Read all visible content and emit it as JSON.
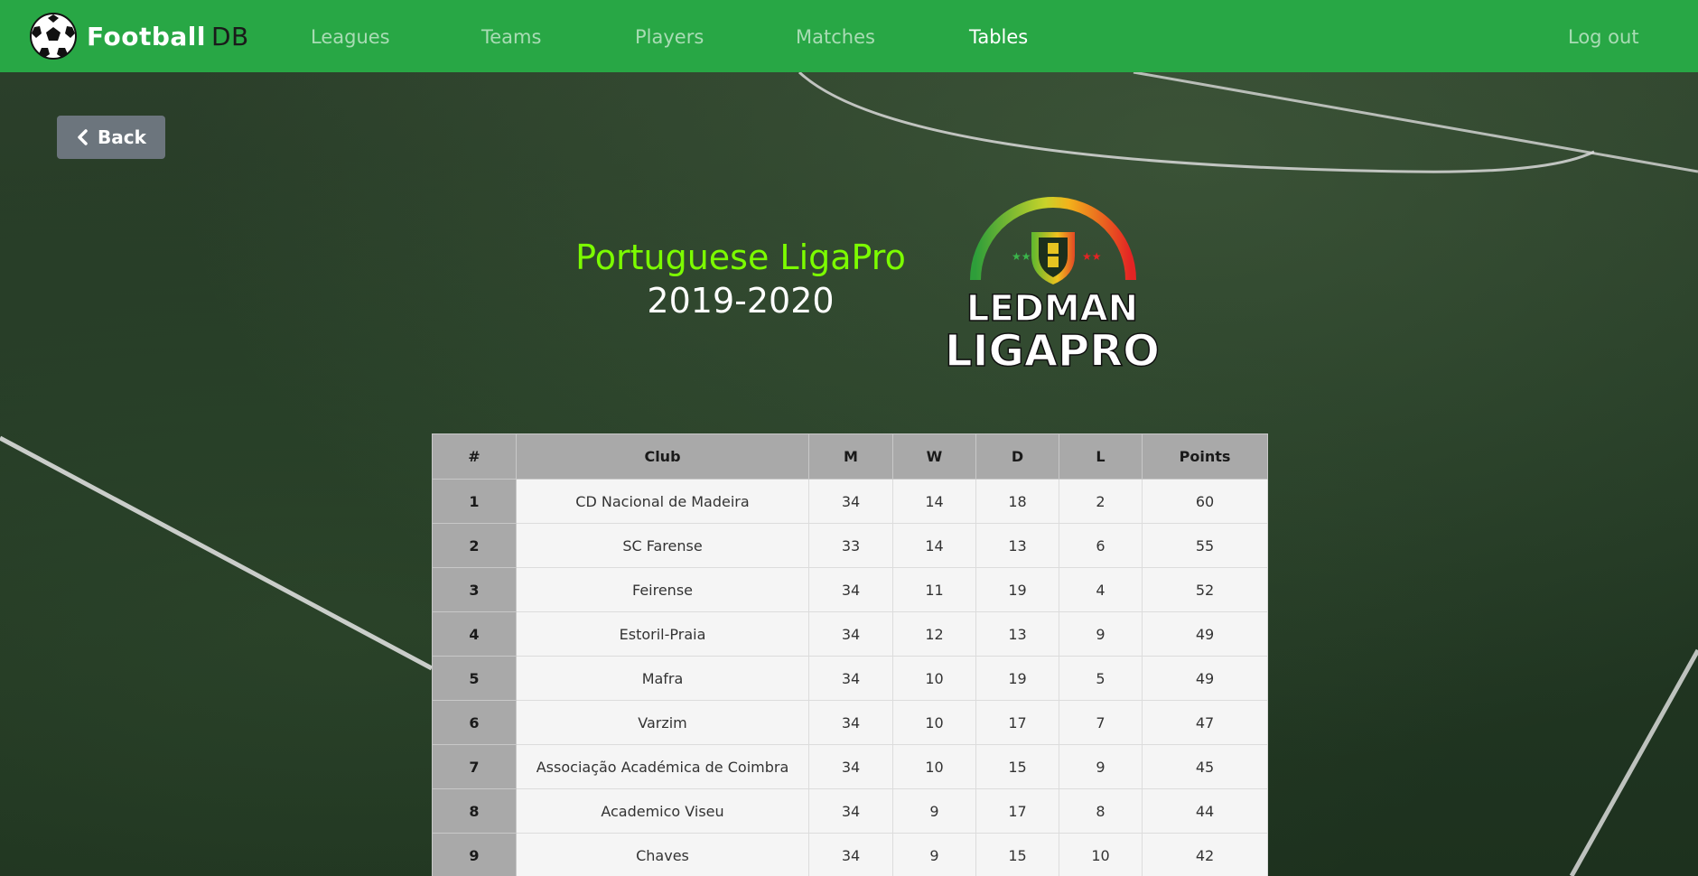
{
  "navbar": {
    "brand_main": "Football",
    "brand_sub": "DB",
    "links": [
      {
        "label": "Leagues"
      },
      {
        "label": "Teams"
      },
      {
        "label": "Players"
      },
      {
        "label": "Matches"
      },
      {
        "label": "Tables",
        "active": true
      }
    ],
    "logout": "Log out",
    "color": "#28a745"
  },
  "back_button": {
    "label": "Back",
    "icon": "chevron-left-icon"
  },
  "header": {
    "league": "Portuguese LigaPro",
    "season": "2019-2020",
    "league_color": "#7cfc00"
  },
  "logo": {
    "line1": "LEDMAN",
    "line2": "LIGAPRO"
  },
  "table": {
    "columns": [
      "#",
      "Club",
      "M",
      "W",
      "D",
      "L",
      "Points"
    ],
    "rows": [
      [
        "1",
        "CD Nacional de Madeira",
        "34",
        "14",
        "18",
        "2",
        "60"
      ],
      [
        "2",
        "SC Farense",
        "33",
        "14",
        "13",
        "6",
        "55"
      ],
      [
        "3",
        "Feirense",
        "34",
        "11",
        "19",
        "4",
        "52"
      ],
      [
        "4",
        "Estoril-Praia",
        "34",
        "12",
        "13",
        "9",
        "49"
      ],
      [
        "5",
        "Mafra",
        "34",
        "10",
        "19",
        "5",
        "49"
      ],
      [
        "6",
        "Varzim",
        "34",
        "10",
        "17",
        "7",
        "47"
      ],
      [
        "7",
        "Associação Académica de Coimbra",
        "34",
        "10",
        "15",
        "9",
        "45"
      ],
      [
        "8",
        "Academico Viseu",
        "34",
        "9",
        "17",
        "8",
        "44"
      ],
      [
        "9",
        "Chaves",
        "34",
        "9",
        "15",
        "10",
        "42"
      ]
    ]
  }
}
